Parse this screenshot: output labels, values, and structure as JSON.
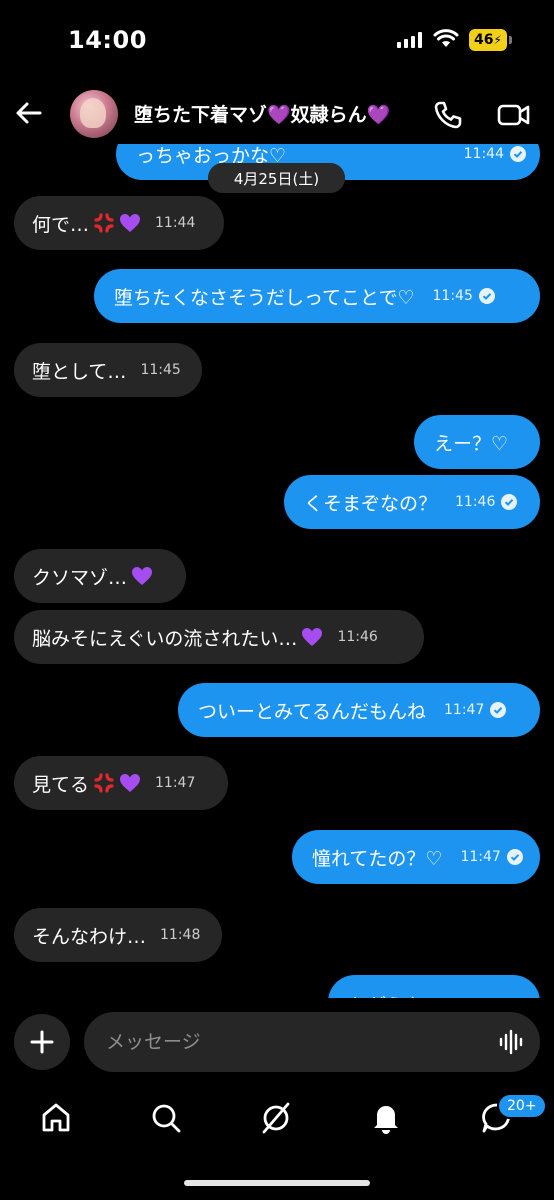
{
  "status": {
    "time": "14:00",
    "battery": "46"
  },
  "header": {
    "title": "堕ちた下着マゾ💜奴隷らん💜"
  },
  "date_separator": "4月25日(土)",
  "messages": [
    {
      "dir": "out",
      "text": "っちゃおっかな♡",
      "time": "11:44"
    },
    {
      "dir": "in",
      "text": "何で…",
      "time": "11:44"
    },
    {
      "dir": "out",
      "text": "堕ちたくなさそうだしってことで♡",
      "time": "11:45"
    },
    {
      "dir": "in",
      "text": "堕として…",
      "time": "11:45"
    },
    {
      "dir": "out",
      "text": "えー？♡",
      "time": ""
    },
    {
      "dir": "out",
      "text": "くそまぞなの？",
      "time": "11:46"
    },
    {
      "dir": "in",
      "text": "クソマゾ…",
      "time": ""
    },
    {
      "dir": "in",
      "text": "脳みそにえぐいの流されたい…",
      "time": "11:46"
    },
    {
      "dir": "out",
      "text": "ついーとみてるんだもんね",
      "time": "11:47"
    },
    {
      "dir": "in",
      "text": "見てる",
      "time": "11:47"
    },
    {
      "dir": "out",
      "text": "憧れてたの？♡",
      "time": "11:47"
    },
    {
      "dir": "in",
      "text": "そんなわけ…",
      "time": "11:48"
    },
    {
      "dir": "out",
      "text": "ちがうな♡",
      "time": ""
    }
  ],
  "composer": {
    "placeholder": "メッセージ"
  },
  "nav": {
    "badge": "20+"
  },
  "colors": {
    "outgoing": "#1d94ef",
    "incoming": "#262626",
    "background": "#000000"
  }
}
